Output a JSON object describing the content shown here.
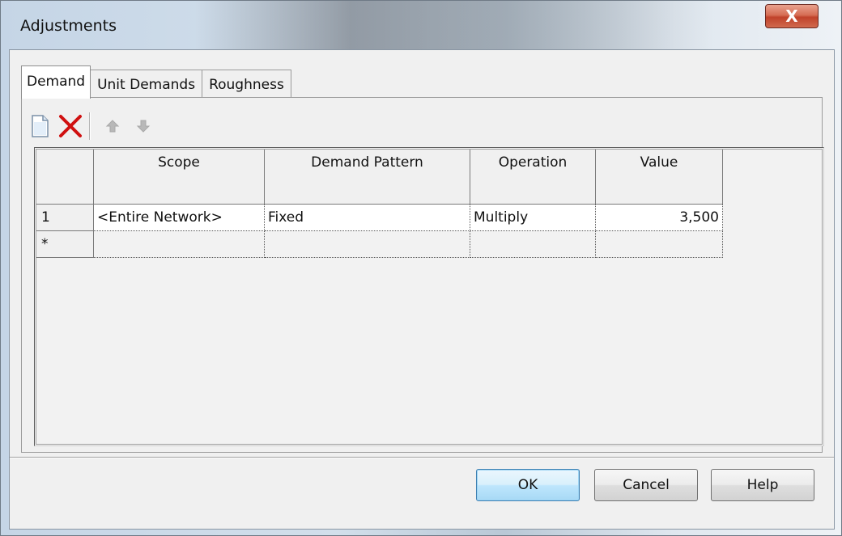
{
  "window": {
    "title": "Adjustments",
    "close_label": "X"
  },
  "tabs": [
    {
      "label": "Demand",
      "active": true
    },
    {
      "label": "Unit Demands",
      "active": false
    },
    {
      "label": "Roughness",
      "active": false
    }
  ],
  "toolbar": {
    "icons": [
      "new-row-icon",
      "delete-icon",
      "move-up-icon",
      "move-down-icon"
    ]
  },
  "grid": {
    "columns": [
      "",
      "Scope",
      "Demand Pattern",
      "Operation",
      "Value"
    ],
    "rows": [
      {
        "row_header": "1",
        "scope": "<Entire Network>",
        "demand_pattern": "Fixed",
        "operation": "Multiply",
        "value": "3,500"
      },
      {
        "row_header": "*",
        "scope": "",
        "demand_pattern": "",
        "operation": "",
        "value": ""
      }
    ]
  },
  "buttons": {
    "ok": "OK",
    "cancel": "Cancel",
    "help": "Help"
  },
  "colors": {
    "close_button": "#c0422a",
    "delete_icon": "#d01010",
    "default_button_border": "#3c7fb1"
  }
}
